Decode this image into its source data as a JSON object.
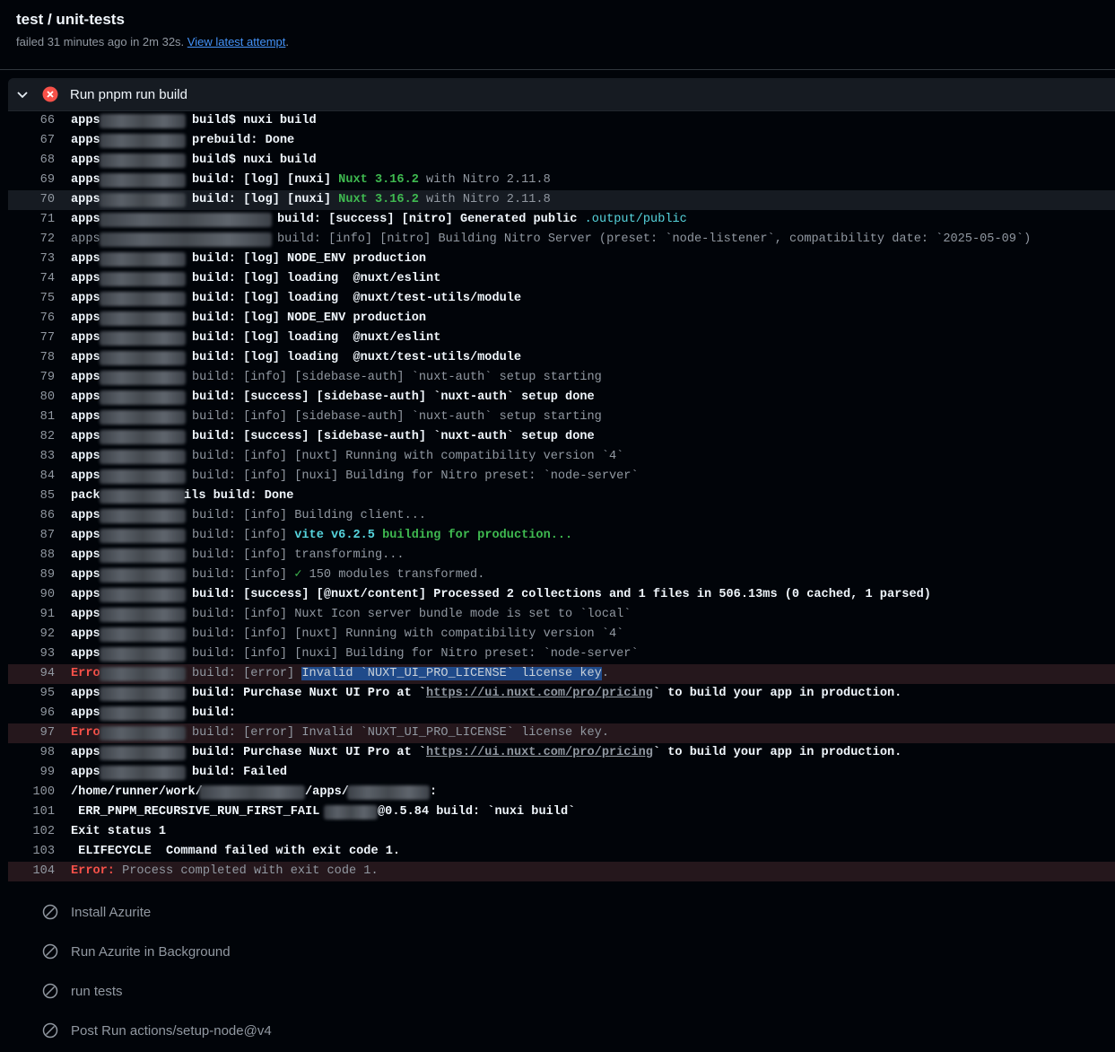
{
  "job": {
    "title": "test / unit-tests",
    "status_prefix": "failed 31 minutes ago in 2m 32s.",
    "latest_link": "View latest attempt",
    "suffix": "."
  },
  "step": {
    "label": "Run pnpm run build",
    "status": "failed",
    "expanded": true
  },
  "log": {
    "l66": {
      "n": "66",
      "pre": "apps",
      "body": "build$ nuxi build"
    },
    "l67": {
      "n": "67",
      "pre": "apps",
      "body": "prebuild: Done"
    },
    "l68": {
      "n": "68",
      "pre": "apps",
      "body": "build$ nuxi build"
    },
    "l69": {
      "n": "69",
      "pre": "apps",
      "a": "build: [log] [nuxi] ",
      "nuxt": "Nuxt 3.16.2",
      "with": " with ",
      "nitro": "Nitro 2.11.8"
    },
    "l70": {
      "n": "70",
      "pre": "apps",
      "a": "build: [log] [nuxi] ",
      "nuxt": "Nuxt 3.16.2",
      "with": " with ",
      "nitro": "Nitro 2.11.8"
    },
    "l71": {
      "n": "71",
      "pre": "apps",
      "a": "build: [success] [nitro] Generated public ",
      "path": ".output/public"
    },
    "l72": {
      "n": "72",
      "pre": "apps",
      "body": "build: [info] [nitro] Building Nitro Server (preset: `node-listener`, compatibility date: `2025-05-09`)"
    },
    "l73": {
      "n": "73",
      "pre": "apps",
      "body": "build: [log] NODE_ENV production"
    },
    "l74": {
      "n": "74",
      "pre": "apps",
      "body": "build: [log] loading  @nuxt/eslint"
    },
    "l75": {
      "n": "75",
      "pre": "apps",
      "body": "build: [log] loading  @nuxt/test-utils/module"
    },
    "l76": {
      "n": "76",
      "pre": "apps",
      "body": "build: [log] NODE_ENV production"
    },
    "l77": {
      "n": "77",
      "pre": "apps",
      "body": "build: [log] loading  @nuxt/eslint"
    },
    "l78": {
      "n": "78",
      "pre": "apps",
      "body": "build: [log] loading  @nuxt/test-utils/module"
    },
    "l79": {
      "n": "79",
      "pre": "apps",
      "body": "build: [info] [sidebase-auth] `nuxt-auth` setup starting"
    },
    "l80": {
      "n": "80",
      "pre": "apps",
      "body": "build: [success] [sidebase-auth] `nuxt-auth` setup done"
    },
    "l81": {
      "n": "81",
      "pre": "apps",
      "body": "build: [info] [sidebase-auth] `nuxt-auth` setup starting"
    },
    "l82": {
      "n": "82",
      "pre": "apps",
      "body": "build: [success] [sidebase-auth] `nuxt-auth` setup done"
    },
    "l83": {
      "n": "83",
      "pre": "apps",
      "body": "build: [info] [nuxt] Running with compatibility version `4`"
    },
    "l84": {
      "n": "84",
      "pre": "apps",
      "body": "build: [info] [nuxi] Building for Nitro preset: `node-server`"
    },
    "l85": {
      "n": "85",
      "pre": "pack",
      "body": "ils build: Done"
    },
    "l86": {
      "n": "86",
      "pre": "apps",
      "body": "build: [info] Building client..."
    },
    "l87": {
      "n": "87",
      "pre": "apps",
      "a": "build: [info] ",
      "vite": "vite v6.2.5",
      "b": " building for production..."
    },
    "l88": {
      "n": "88",
      "pre": "apps",
      "body": "build: [info] transforming..."
    },
    "l89": {
      "n": "89",
      "pre": "apps",
      "a": "build: [info] ",
      "check": "✓",
      "b": " 150 modules transformed."
    },
    "l90": {
      "n": "90",
      "pre": "apps",
      "body": "build: [success] [@nuxt/content] Processed 2 collections and 1 files in 506.13ms (0 cached, 1 parsed)"
    },
    "l91": {
      "n": "91",
      "pre": "apps",
      "body": "build: [info] Nuxt Icon server bundle mode is set to `local`"
    },
    "l92": {
      "n": "92",
      "pre": "apps",
      "body": "build: [info] [nuxt] Running with compatibility version `4`"
    },
    "l93": {
      "n": "93",
      "pre": "apps",
      "body": "build: [info] [nuxi] Building for Nitro preset: `node-server`"
    },
    "l94": {
      "n": "94",
      "pre": "Erro",
      "a": "build: [error] ",
      "sel": "Invalid `NUXT_UI_PRO_LICENSE` license key",
      "b": "."
    },
    "l95": {
      "n": "95",
      "pre": "apps",
      "a": "build: Purchase Nuxt UI Pro at `",
      "url": "https://ui.nuxt.com/pro/pricing",
      "b": "` to build your app in production."
    },
    "l96": {
      "n": "96",
      "pre": "apps",
      "body": "build:"
    },
    "l97": {
      "n": "97",
      "pre": "Erro",
      "body": "build: [error] Invalid `NUXT_UI_PRO_LICENSE` license key."
    },
    "l98": {
      "n": "98",
      "pre": "apps",
      "a": "build: Purchase Nuxt UI Pro at `",
      "url": "https://ui.nuxt.com/pro/pricing",
      "b": "` to build your app in production."
    },
    "l99": {
      "n": "99",
      "pre": "apps",
      "body": "build: Failed"
    },
    "l100": {
      "n": "100",
      "a": "/home/runner/work/",
      "b": "/apps/",
      "c": ":"
    },
    "l101": {
      "n": "101",
      "a": " ERR_PNPM_RECURSIVE_RUN_FIRST_FAIL ",
      "b": "@0.5.84 build: `nuxi build`"
    },
    "l102": {
      "n": "102",
      "body": "Exit status 1"
    },
    "l103": {
      "n": "103",
      "body": " ELIFECYCLE  Command failed with exit code 1."
    },
    "l104": {
      "n": "104",
      "err": "Error:",
      "body": " Process completed with exit code 1."
    }
  },
  "steps": [
    {
      "label": "Install Azurite",
      "status": "skipped"
    },
    {
      "label": "Run Azurite in Background",
      "status": "skipped"
    },
    {
      "label": "run tests",
      "status": "skipped"
    },
    {
      "label": "Post Run actions/setup-node@v4",
      "status": "skipped"
    }
  ],
  "colors": {
    "bg": "#010409",
    "fail": "#f85149",
    "link": "#4493f8",
    "green": "#3fb950",
    "cyan": "#56d4dd",
    "selection": "#1f4a8a"
  }
}
